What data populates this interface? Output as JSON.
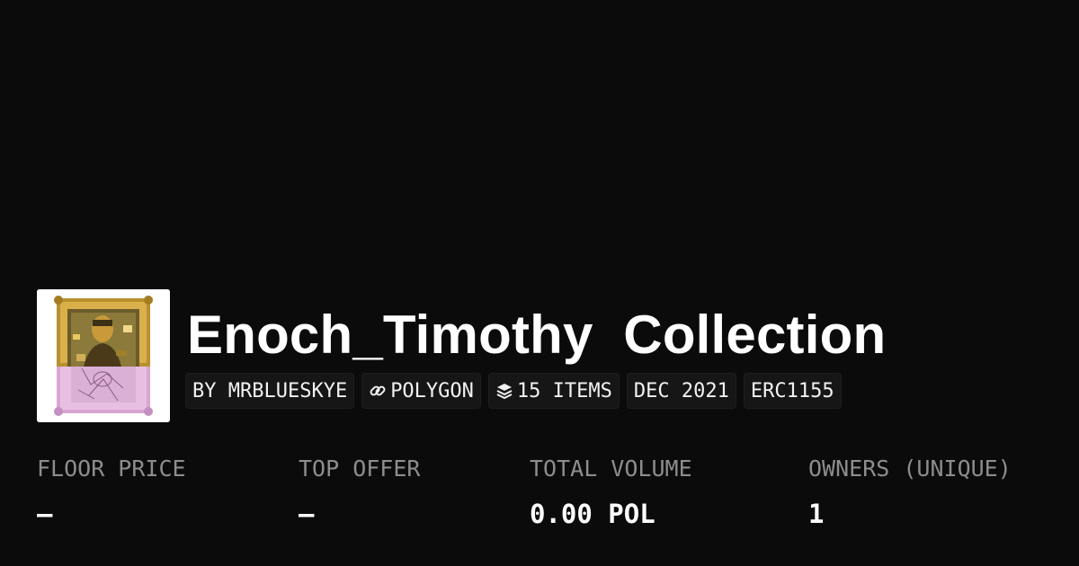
{
  "collection": {
    "name": "Enoch_Timothy  Collection",
    "chips": {
      "creator": "BY MRBLUESKYE",
      "chain": "POLYGON",
      "items": "15 ITEMS",
      "date": "DEC 2021",
      "standard": "ERC1155"
    },
    "thumbnail_icon": "framed-mona-lisa-artwork"
  },
  "stats": [
    {
      "label": "FLOOR PRICE",
      "value": "–"
    },
    {
      "label": "TOP OFFER",
      "value": "–"
    },
    {
      "label": "TOTAL VOLUME",
      "value": "0.00 POL"
    },
    {
      "label": "OWNERS (UNIQUE)",
      "value": "1"
    }
  ],
  "icons": {
    "chain": "link-icon",
    "items": "layers-icon"
  },
  "colors": {
    "background": "#0b0b0b",
    "chip_background": "#161616",
    "label": "#8d8d8d",
    "text": "#ffffff"
  }
}
